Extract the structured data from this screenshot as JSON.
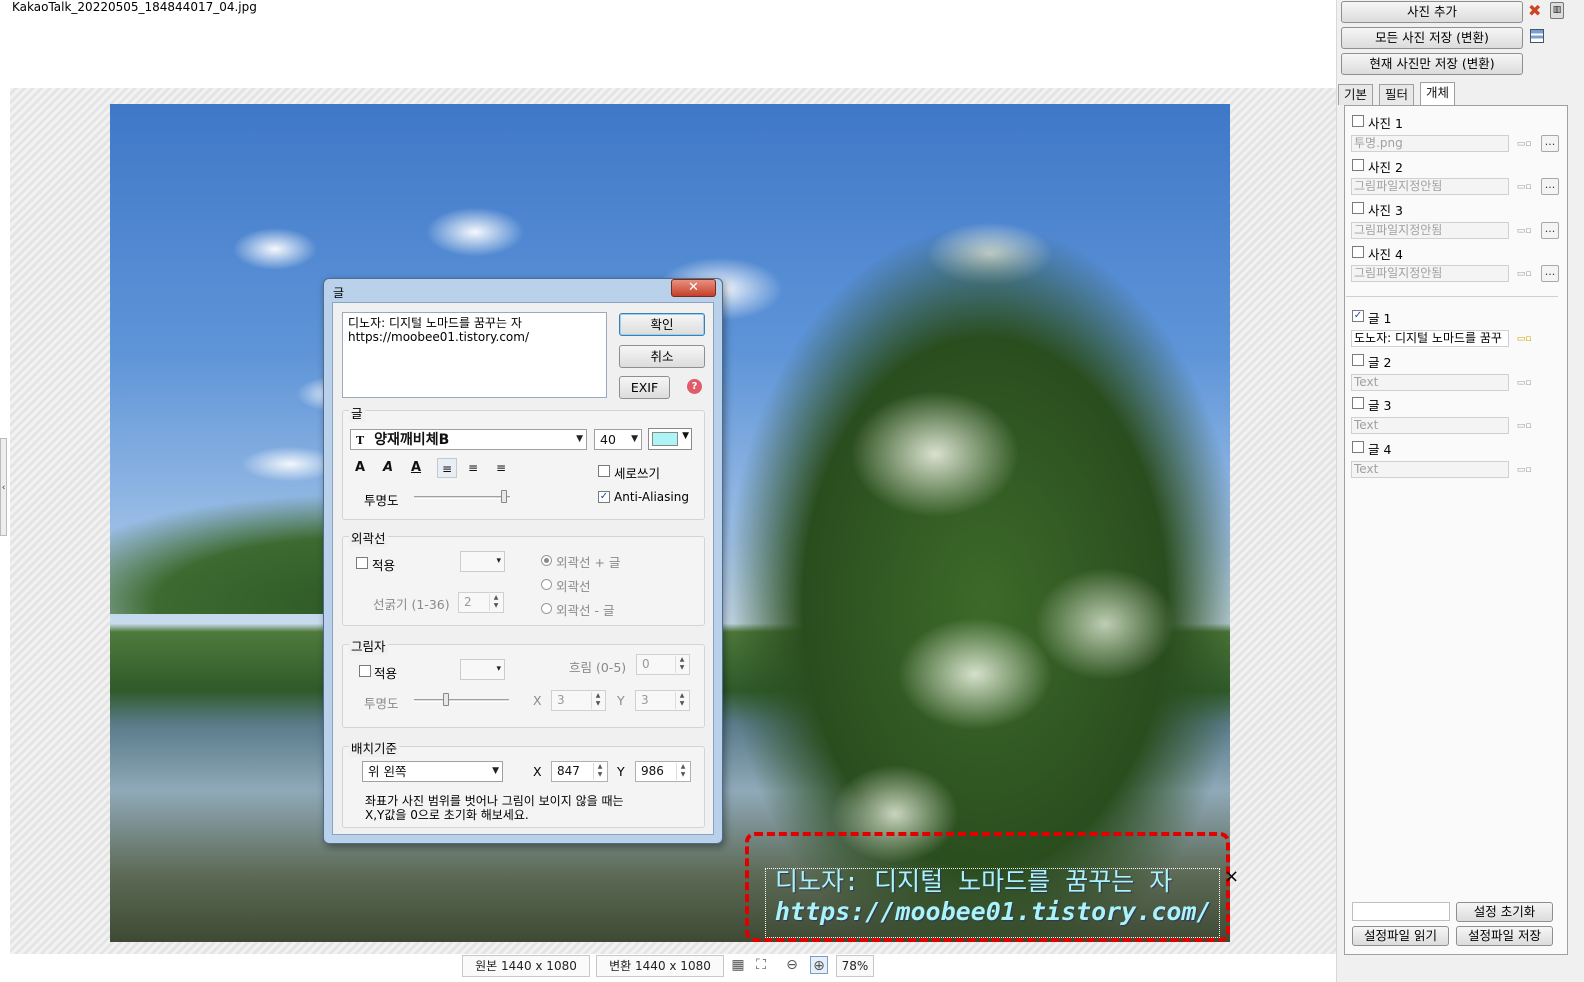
{
  "file_title": "KakaoTalk_20220505_184844017_04.jpg",
  "overlay": {
    "line1": "디노자: 디지털 노마드를 꿈꾸는 자",
    "line2": "https://moobee01.tistory.com/",
    "close_symbol": "×"
  },
  "status": {
    "original": "원본 1440 x 1080",
    "converted": "변환 1440 x 1080",
    "zoom": "78%"
  },
  "right_panel": {
    "buttons": {
      "add_photo": "사진 추가",
      "save_all": "모든 사진 저장 (변환)",
      "save_current": "현재 사진만 저장 (변환)",
      "reset_settings": "설정 초기화",
      "read_settings": "설정파일 읽기",
      "save_settings": "설정파일 저장"
    },
    "tabs": [
      {
        "label": "기본"
      },
      {
        "label": "필터"
      },
      {
        "label": "개체"
      }
    ],
    "photos": [
      {
        "label": "사진 1",
        "file": "투명.png",
        "checked": false
      },
      {
        "label": "사진 2",
        "file": "그림파일지정안됨",
        "checked": false
      },
      {
        "label": "사진 3",
        "file": "그림파일지정안됨",
        "checked": false
      },
      {
        "label": "사진 4",
        "file": "그림파일지정안됨",
        "checked": false
      }
    ],
    "texts": [
      {
        "label": "글 1",
        "value": "도노자: 디지털 노마드를 꿈꾸",
        "checked": true
      },
      {
        "label": "글 2",
        "value": "Text",
        "checked": false
      },
      {
        "label": "글 3",
        "value": "Text",
        "checked": false
      },
      {
        "label": "글 4",
        "value": "Text",
        "checked": false
      }
    ],
    "dots": "...",
    "check_mark": "✓"
  },
  "dialog": {
    "title": "글",
    "close_symbol": "✕",
    "text_line1": "디노자: 디지털 노마드를 꿈꾸는 자",
    "text_line2": "https://moobee01.tistory.com/",
    "ok": "확인",
    "cancel": "취소",
    "exif": "EXIF",
    "help_symbol": "?",
    "text_group": {
      "title": "글",
      "font_name": "양재깨비체B",
      "font_icon": "T",
      "size": "40",
      "color": "#aef4f6",
      "bold": "A",
      "italic": "A",
      "underline": "A",
      "vertical": "세로쓰기",
      "antialias": "Anti-Aliasing",
      "antialias_checked": true,
      "opacity_label": "투명도"
    },
    "outline_group": {
      "title": "외곽선",
      "apply": "적용",
      "thickness_label": "선굵기 (1-36)",
      "thickness": "2",
      "options": [
        "외곽선 + 글",
        "외곽선",
        "외곽선 - 글"
      ],
      "selected": 0
    },
    "shadow_group": {
      "title": "그림자",
      "apply": "적용",
      "blur_label": "흐림 (0-5)",
      "blur": "0",
      "opacity_label": "투명도",
      "x_label": "X",
      "x": "3",
      "y_label": "Y",
      "y": "3"
    },
    "position_group": {
      "title": "배치기준",
      "anchor": "위 왼쪽",
      "x_label": "X",
      "x": "847",
      "y_label": "Y",
      "y": "986",
      "note_line1": "좌표가 사진 범위를 벗어나 그림이 보이지 않을 때는",
      "note_line2": "X,Y값을 0으로 초기화 해보세요."
    }
  }
}
